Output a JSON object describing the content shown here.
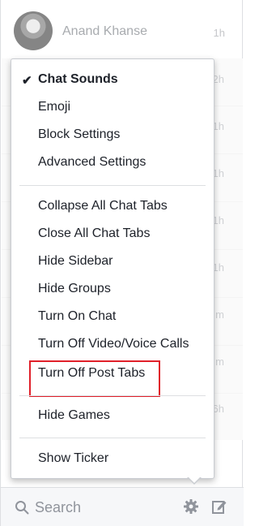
{
  "contact": {
    "name": "Anand Khanse",
    "time": "1h"
  },
  "background_times": [
    "2h",
    "1h",
    "1h",
    "1h",
    "1h",
    "m",
    "m",
    "6h"
  ],
  "menu": {
    "sections": [
      {
        "items": [
          {
            "label": "Chat Sounds",
            "checked": true
          },
          {
            "label": "Emoji"
          },
          {
            "label": "Block Settings"
          },
          {
            "label": "Advanced Settings"
          }
        ]
      },
      {
        "items": [
          {
            "label": "Collapse All Chat Tabs"
          },
          {
            "label": "Close All Chat Tabs"
          },
          {
            "label": "Hide Sidebar"
          },
          {
            "label": "Hide Groups"
          },
          {
            "label": "Turn On Chat"
          },
          {
            "label": "Turn Off Video/Voice Calls"
          },
          {
            "label": "Turn Off Post Tabs",
            "highlighted": true
          }
        ]
      },
      {
        "items": [
          {
            "label": "Hide Games"
          }
        ]
      },
      {
        "items": [
          {
            "label": "Show Ticker"
          }
        ]
      }
    ]
  },
  "bottom_bar": {
    "search_placeholder": "Search",
    "icons": [
      "search-icon",
      "gear-icon",
      "compose-icon"
    ]
  },
  "colors": {
    "highlight_border": "#e0202a",
    "menu_border": "#c9ccd1"
  }
}
